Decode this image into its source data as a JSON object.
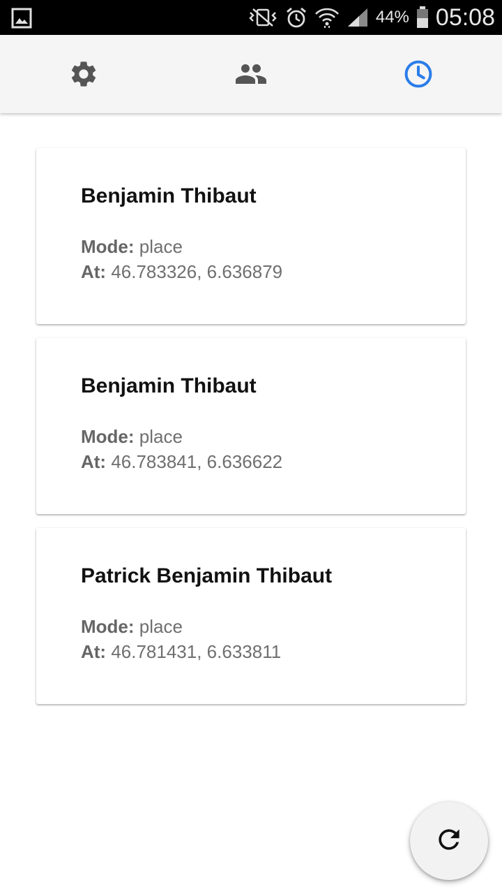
{
  "status_bar": {
    "battery_percent": "44%",
    "time": "05:08",
    "icons": [
      "gallery-notification-icon",
      "vibrate-icon",
      "alarm-icon",
      "wifi-icon",
      "signal-icon",
      "battery-icon"
    ]
  },
  "nav": {
    "tabs": [
      {
        "icon": "settings-icon",
        "active": false
      },
      {
        "icon": "people-icon",
        "active": false
      },
      {
        "icon": "history-clock-icon",
        "active": true
      }
    ],
    "active_color": "#2b7de9",
    "inactive_color": "#555555"
  },
  "cards": [
    {
      "name": "Benjamin Thibaut",
      "mode_label": "Mode:",
      "mode_value": "place",
      "at_label": "At:",
      "at_value": "46.783326, 6.636879"
    },
    {
      "name": "Benjamin Thibaut",
      "mode_label": "Mode:",
      "mode_value": "place",
      "at_label": "At:",
      "at_value": "46.783841, 6.636622"
    },
    {
      "name": "Patrick Benjamin Thibaut",
      "mode_label": "Mode:",
      "mode_value": "place",
      "at_label": "At:",
      "at_value": "46.781431, 6.633811"
    }
  ],
  "fab": {
    "icon": "refresh-icon"
  }
}
